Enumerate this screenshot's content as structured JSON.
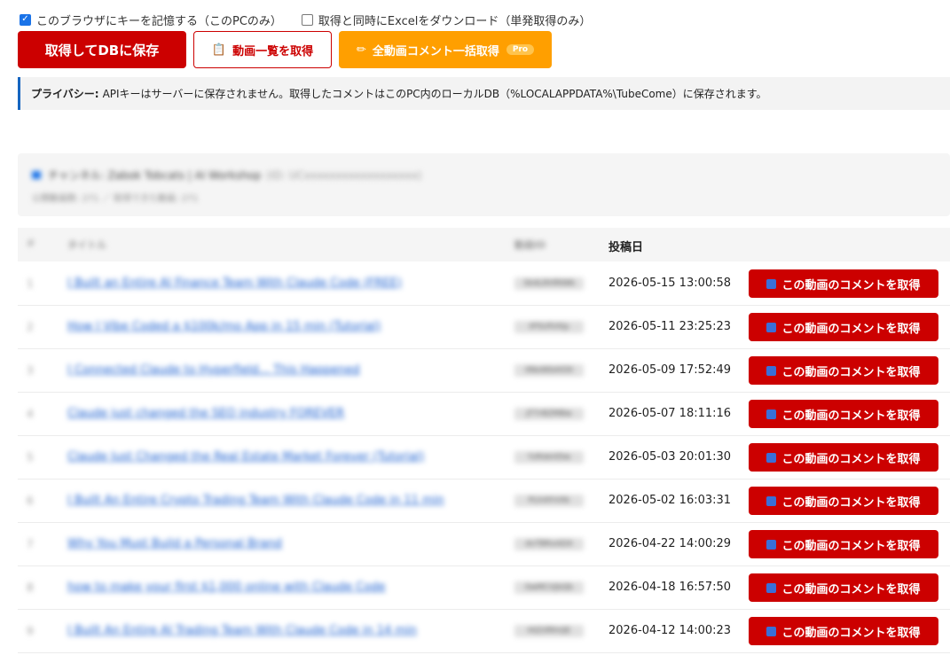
{
  "options": {
    "remember_key": {
      "label": "このブラウザにキーを記憶する（このPCのみ）",
      "checked": true
    },
    "excel_download": {
      "label": "取得と同時にExcelをダウンロード（単発取得のみ）",
      "checked": false
    }
  },
  "buttons": {
    "save_label": "取得してDBに保存",
    "list_label": "動画一覧を取得",
    "list_icon": "clipboard-icon",
    "all_label": "全動画コメント一括取得",
    "all_icon": "pencil-icon",
    "pro_badge": "Pro"
  },
  "privacy": {
    "heading": "プライバシー:",
    "text": "APIキーはサーバーに保存されません。取得したコメントはこのPC内のローカルDB（%LOCALAPPDATA%\\TubeCome）に保存されます。"
  },
  "channel": {
    "line1": "チャンネル: Zabok Tobcats | AI Workshop",
    "line1_sub": "(ID: UCxxxxxxxxxxxxxxxxxx)",
    "line2": "公開動画数: 271 ／ 取得できた動画: 271"
  },
  "table": {
    "headers": {
      "num": "#",
      "title": "タイトル",
      "id": "動画ID",
      "date": "投稿日"
    },
    "button_label": "この動画のコメントを取得",
    "rows": [
      {
        "num": "1",
        "title": "I Built an Entire AI Finance Team With Claude Code (FREE)",
        "id": "Sk4LRHfKNN",
        "date": "2026-05-15 13:00:58"
      },
      {
        "num": "2",
        "title": "How I Vibe Coded a $100k/mo App in 15 min (Tutorial)",
        "id": "tP5UfVXlp",
        "date": "2026-05-11 23:25:23"
      },
      {
        "num": "3",
        "title": "I Connected Claude to Hyperfield... This Happened",
        "id": "0NoWbAlO0",
        "date": "2026-05-09 17:52:49"
      },
      {
        "num": "4",
        "title": "Claude just changed the SEO industry FOREVER",
        "id": "JT7rBZMBw",
        "date": "2026-05-07 18:11:16"
      },
      {
        "num": "5",
        "title": "Claude Just Changed the Real Estate Market Forever (Tutorial)",
        "id": "YzRdeVDw",
        "date": "2026-05-03 20:01:30"
      },
      {
        "num": "6",
        "title": "I Built An Entire Crypto Trading Team With Claude Code in 11 min",
        "id": "PLhXfrVXk",
        "date": "2026-05-02 16:03:31"
      },
      {
        "num": "7",
        "title": "Why You Must Build a Personal Brand",
        "id": "dvTBRxADX",
        "date": "2026-04-22 14:00:29"
      },
      {
        "num": "8",
        "title": "how to make your first $1,000 online with Claude Code",
        "id": "0wMCVjbQb",
        "date": "2026-04-18 16:57:50"
      },
      {
        "num": "9",
        "title": "I Built An Entire AI Trading Team With Claude Code in 14 min",
        "id": "HIZiifRhQE",
        "date": "2026-04-12 14:00:23"
      }
    ]
  },
  "colors": {
    "primary": "#cc0000",
    "accent": "#ff9f00",
    "link": "#1a5fd0",
    "privacy_border": "#1565c0"
  }
}
